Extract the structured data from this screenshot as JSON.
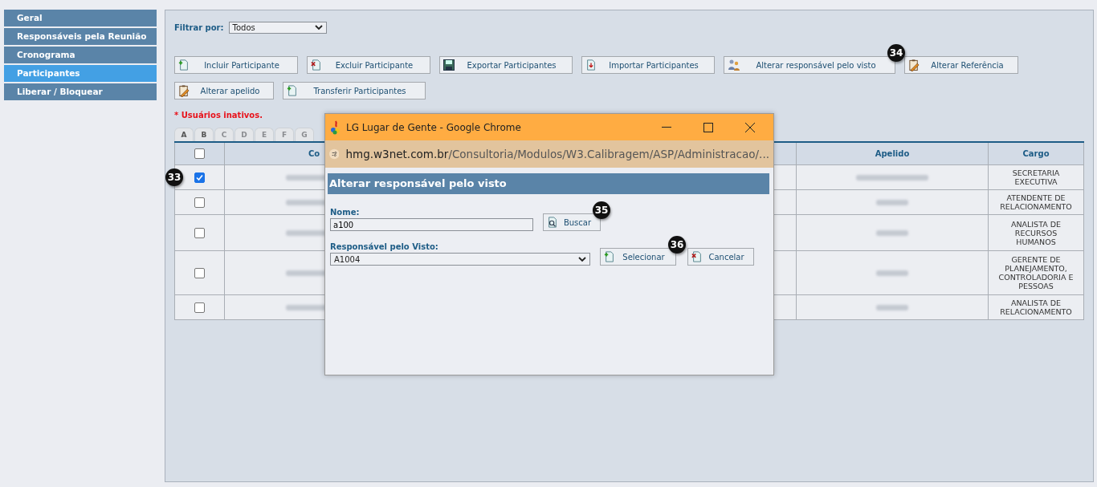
{
  "sidebar": {
    "items": [
      {
        "label": "Geral",
        "selected": false
      },
      {
        "label": "Responsáveis pela Reunião",
        "selected": false
      },
      {
        "label": "Cronograma",
        "selected": false
      },
      {
        "label": "Participantes",
        "selected": true
      },
      {
        "label": "Liberar / Bloquear",
        "selected": false
      }
    ]
  },
  "filter": {
    "label": "Filtrar por:",
    "value": "Todos"
  },
  "toolbar": [
    [
      {
        "label": "Incluir Participante",
        "kind": "add"
      },
      {
        "label": "Excluir Participante",
        "kind": "delete"
      },
      {
        "label": "Exportar Participantes",
        "kind": "save"
      },
      {
        "label": "Importar Participantes",
        "kind": "import"
      },
      {
        "label": "Alterar responsável pelo visto",
        "kind": "people",
        "badge": "34"
      },
      {
        "label": "Alterar Referência",
        "kind": "edit"
      }
    ],
    [
      {
        "label": "Alterar apelido",
        "kind": "edit"
      },
      {
        "label": "Transferir Participantes",
        "kind": "add"
      }
    ]
  ],
  "inactive_note": "* Usuários inativos.",
  "letter_tabs": [
    {
      "label": "A",
      "disabled": false
    },
    {
      "label": "B",
      "disabled": false
    },
    {
      "label": "C",
      "disabled": true
    },
    {
      "label": "D",
      "disabled": true
    },
    {
      "label": "E",
      "disabled": true
    },
    {
      "label": "F",
      "disabled": true
    },
    {
      "label": "G",
      "disabled": true
    }
  ],
  "table": {
    "select_all_checked": false,
    "columns": [
      "Co",
      "Apelido",
      "Cargo"
    ],
    "rows": [
      {
        "checked": true,
        "badge": "33",
        "cargo": "SECRETARIA EXECUTIVA"
      },
      {
        "checked": false,
        "cargo": "ATENDENTE DE RELACIONAMENTO"
      },
      {
        "checked": false,
        "cargo": "ANALISTA DE RECURSOS HUMANOS"
      },
      {
        "checked": false,
        "cargo": "GERENTE DE PLANEJAMENTO, CONTROLADORIA E PESSOAS"
      },
      {
        "checked": false,
        "cargo": "ANALISTA DE RELACIONAMENTO"
      }
    ]
  },
  "popup": {
    "title": "LG Lugar de Gente - Google Chrome",
    "url_host": "hmg.w3net.com.br",
    "url_path": "/Consultoria/Modulos/W3.Calibragem/ASP/Administracao/...",
    "heading": "Alterar responsável pelo visto",
    "name_label": "Nome:",
    "name_value": "a100",
    "search_button": {
      "label": "Buscar",
      "badge": "35"
    },
    "select_label": "Responsável pelo Visto:",
    "select_value": "A1004",
    "buttons": [
      {
        "label": "Selecionar",
        "kind": "add",
        "badge": "36"
      },
      {
        "label": "Cancelar",
        "kind": "delete"
      }
    ]
  }
}
